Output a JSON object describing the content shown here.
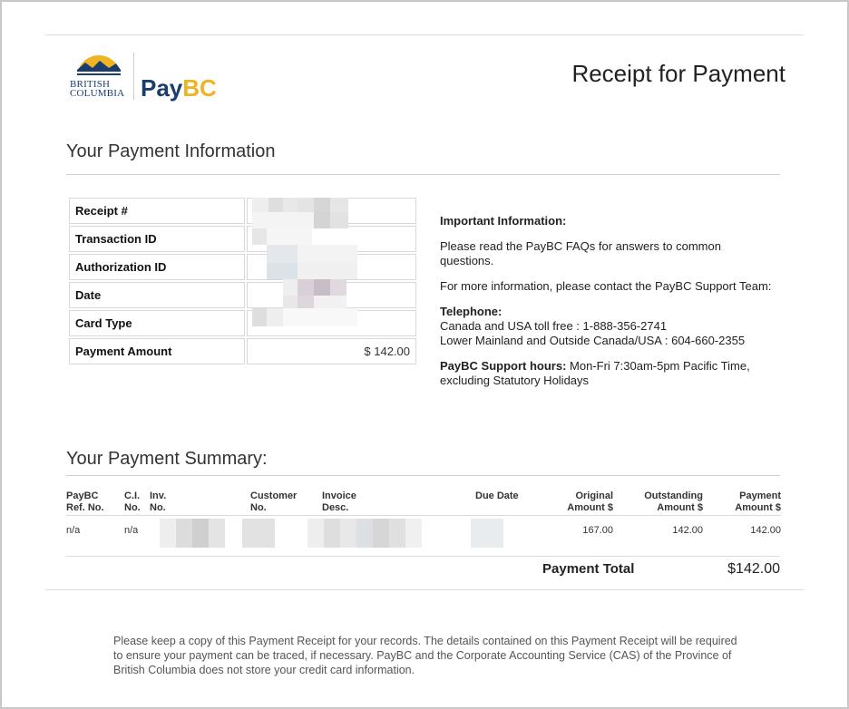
{
  "header": {
    "bc_logo_text": [
      "BRITISH",
      "COLUMBIA"
    ],
    "brand_pay": "Pay",
    "brand_bc": "BC",
    "title": "Receipt for Payment"
  },
  "payment_info": {
    "heading": "Your Payment Information",
    "rows": [
      {
        "label": "Receipt #",
        "value": ""
      },
      {
        "label": "Transaction ID",
        "value": ""
      },
      {
        "label": "Authorization ID",
        "value": ""
      },
      {
        "label": "Date",
        "value": ""
      },
      {
        "label": "Card Type",
        "value": ""
      },
      {
        "label": "Payment Amount",
        "value": "$ 142.00"
      }
    ]
  },
  "important": {
    "heading": "Important Information:",
    "faq": "Please read the PayBC FAQs for answers to common questions.",
    "contact": "For more information, please contact the PayBC Support Team:",
    "telephone_heading": "Telephone:",
    "phone_line1": "Canada and USA toll free : 1-888-356-2741",
    "phone_line2": "Lower Mainland and Outside Canada/USA : 604-660-2355",
    "hours_label": "PayBC Support hours:",
    "hours_text": " Mon-Fri 7:30am-5pm Pacific Time, excluding Statutory Holidays"
  },
  "summary": {
    "heading": "Your Payment Summary:",
    "columns": [
      {
        "l1": "PayBC",
        "l2": "Ref. No."
      },
      {
        "l1": "C.I.",
        "l2": "No."
      },
      {
        "l1": "Inv.",
        "l2": "No."
      },
      {
        "l1": "Customer",
        "l2": "No."
      },
      {
        "l1": "Invoice",
        "l2": "Desc."
      },
      {
        "l1": "Due Date",
        "l2": ""
      },
      {
        "l1": "Original",
        "l2": "Amount $"
      },
      {
        "l1": "Outstanding",
        "l2": "Amount $"
      },
      {
        "l1": "Payment",
        "l2": "Amount $"
      }
    ],
    "row": {
      "ref_no": "n/a",
      "ci_no": "n/a",
      "original": "167.00",
      "outstanding": "142.00",
      "payment": "142.00"
    },
    "total_label": "Payment Total",
    "total_value": "$142.00"
  },
  "footer": {
    "note": "Please keep a copy of this Payment Receipt for your records. The details contained on this Payment Receipt will be required to ensure your payment can be traced, if necessary. PayBC and the Corporate Accounting Service (CAS) of the Province of British Columbia does not store your credit card information."
  },
  "colors": {
    "brand_blue": "#1a3d6e",
    "brand_gold": "#f0b323"
  }
}
